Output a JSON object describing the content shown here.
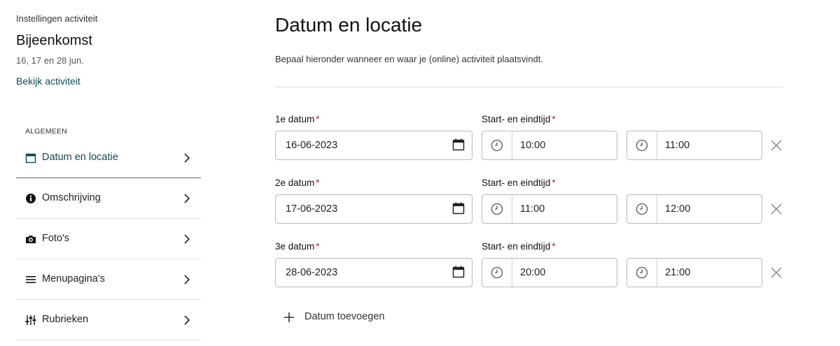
{
  "sidebar": {
    "eyebrow": "Instellingen activiteit",
    "title": "Bijeenkomst",
    "dates": "16, 17 en 28 jun.",
    "view_link": "Bekijk activiteit",
    "section": "ALGEMEEN",
    "items": [
      {
        "label": "Datum en locatie",
        "icon": "calendar-icon",
        "active": true
      },
      {
        "label": "Omschrijving",
        "icon": "info-icon",
        "active": false
      },
      {
        "label": "Foto's",
        "icon": "camera-icon",
        "active": false
      },
      {
        "label": "Menupagina's",
        "icon": "menu-icon",
        "active": false
      },
      {
        "label": "Rubrieken",
        "icon": "sliders-icon",
        "active": false
      }
    ]
  },
  "main": {
    "title": "Datum en locatie",
    "intro": "Bepaal hieronder wanneer en waar je (online) activiteit plaatsvindt.",
    "time_label": "Start- en eindtijd",
    "required_mark": "*",
    "rows": [
      {
        "date_label": "1e datum",
        "date": "16-06-2023",
        "start": "10:00",
        "end": "11:00"
      },
      {
        "date_label": "2e datum",
        "date": "17-06-2023",
        "start": "11:00",
        "end": "12:00"
      },
      {
        "date_label": "3e datum",
        "date": "28-06-2023",
        "start": "20:00",
        "end": "21:00"
      }
    ],
    "add_label": "Datum toevoegen"
  },
  "colors": {
    "accent": "#0d4a55",
    "required": "#bb2222",
    "border": "#b9b9b9"
  }
}
